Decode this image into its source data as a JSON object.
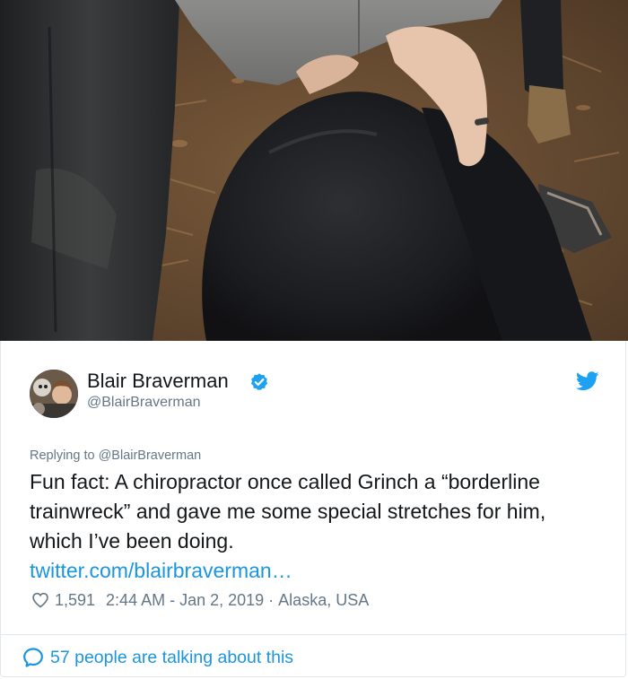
{
  "tweet": {
    "author_name": "Blair Braverman",
    "handle": "@BlairBraverman",
    "reply_prefix": "Replying to ",
    "reply_to": "@BlairBraverman",
    "text": "Fun fact: A chiropractor once called Grinch a “borderline trainwreck” and gave me some special stretches for him, which I’ve been doing.",
    "link": "twitter.com/blairbraverman…",
    "likes": "1,591",
    "time": "2:44 AM - Jan 2, 2019",
    "separator": " · ",
    "location": "Alaska, USA",
    "talking": "57 people are talking about this"
  },
  "icons": {
    "verified": "verified-badge-icon",
    "platform": "twitter-bird-icon",
    "like": "heart-outline-icon",
    "conversation": "speech-bubble-icon"
  },
  "colors": {
    "link": "#1b95e0",
    "text": "#14171a",
    "secondary": "#657786",
    "border": "#e1e8ed"
  }
}
